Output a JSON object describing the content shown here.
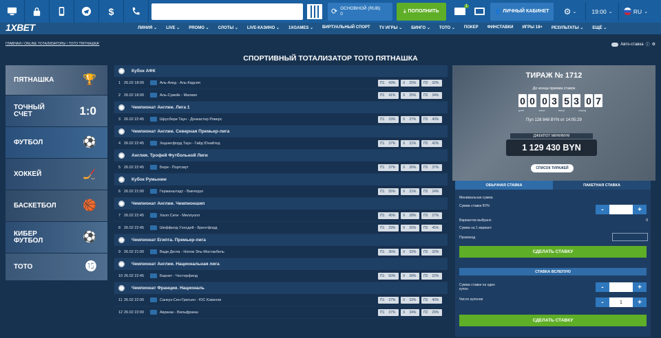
{
  "topbar": {
    "account_label": "ОСНОВНОЙ (RUB)",
    "account_value": "0",
    "deposit_label": "ПОПОЛНИТЬ",
    "mail_count": "1",
    "cabinet_label": "ЛИЧНЫЙ КАБИНЕТ",
    "time": "19:00",
    "language": "RU"
  },
  "nav": {
    "logo": "1XBET",
    "items": [
      "ЛИНИЯ ⌄",
      "LIVE ⌄",
      "PROMO ⌄",
      "СЛОТЫ ⌄",
      "LIVE-КАЗИНО ⌄",
      "1XGAMES ⌄",
      "ВИРТУАЛЬНЫЙ СПОРТ",
      "TV ИГРЫ ⌄",
      "БИНГО ⌄",
      "ТОТО ⌄",
      "ПОКЕР",
      "ФИНСТАВКИ",
      "ИГРЫ 18+",
      "РЕЗУЛЬТАТЫ ⌄",
      "ЕЩЁ ⌄"
    ]
  },
  "breadcrumb": "ГЛАВНАЯ / ONLINE ТОТАЛИЗАТОРЫ / ТОТО 'ПЯТНАШКА'",
  "autobet_label": "Авто-ставка",
  "page_title": "СПОРТИВНЫЙ ТОТАЛИЗАТОР ТОТО ПЯТНАШКА",
  "sidebar": [
    {
      "label": "ПЯТНАШКА",
      "icon": "trophy-icon"
    },
    {
      "label": "ТОЧНЫЙ СЧЕТ",
      "icon": "score-text",
      "extra": "1:0"
    },
    {
      "label": "ФУТБОЛ",
      "icon": "football-icon"
    },
    {
      "label": "ХОККЕЙ",
      "icon": "puck-icon"
    },
    {
      "label": "БАСКЕТБОЛ",
      "icon": "basketball-icon"
    },
    {
      "label": "КИБЕР ФУТБОЛ",
      "icon": "cyber-football-icon"
    },
    {
      "label": "ТОТО",
      "icon": "toto-icon"
    }
  ],
  "matches": [
    {
      "league": "Кубок АФК",
      "num": "1",
      "dt": "26.02 18:00",
      "teams": "Аль-Ахед - Аль-Кадсия",
      "p1": "43%",
      "x": "25%",
      "p2": "32%"
    },
    {
      "league": "",
      "num": "2",
      "dt": "26.02 18:00",
      "teams": "Аль-Сувейк - Малкия",
      "p1": "41%",
      "x": "25%",
      "p2": "34%"
    },
    {
      "league": "Чемпионат Англии. Лига 1",
      "num": "3",
      "dt": "26.02 22:45",
      "teams": "Шрусбери Таун - Донкастер Роверс",
      "p1": "33%",
      "x": "27%",
      "p2": "40%"
    },
    {
      "league": "Чемпионат Англии. Северная Премьер-лига",
      "num": "4",
      "dt": "26.02 22:45",
      "teams": "Хеднесфорд Таун - Гайд Юнайтед",
      "p1": "37%",
      "x": "21%",
      "p2": "42%"
    },
    {
      "league": "Англия. Трофей Футбольной Лиги",
      "num": "5",
      "dt": "26.02 22:45",
      "teams": "Бери - Портсмут",
      "p1": "37%",
      "x": "26%",
      "p2": "37%"
    },
    {
      "league": "Кубок Румынии",
      "num": "6",
      "dt": "26.02 21:00",
      "teams": "Германштадт - Виитеруп",
      "p1": "55%",
      "x": "21%",
      "p2": "24%"
    },
    {
      "league": "Чемпионат Англии. Чемпионшип",
      "num": "7",
      "dt": "26.02 22:45",
      "teams": "Халл Сити - Миллуолл",
      "p1": "45%",
      "x": "28%",
      "p2": "27%"
    },
    {
      "league": "",
      "num": "8",
      "dt": "26.02 22:45",
      "teams": "Шеффилд Уэнсдей - Брентфорд",
      "p1": "29%",
      "x": "26%",
      "p2": "45%"
    },
    {
      "league": "Чемпионат Египта. Премьер-лига",
      "num": "9",
      "dt": "26.02 21:00",
      "teams": "Вади Дегла - Ногом Эль-Мостакбель",
      "p1": "36%",
      "x": "32%",
      "p2": "32%"
    },
    {
      "league": "Чемпионат Англии. Национальная лига",
      "num": "10",
      "dt": "26.02 22:45",
      "teams": "Барнет - Честерфилд",
      "p1": "50%",
      "x": "28%",
      "p2": "22%"
    },
    {
      "league": "Чемпионат Франции. Националь",
      "num": "11",
      "dt": "26.02 22:00",
      "teams": "Санкуэ-Сен-Гратьен - ЮС Кэвилли",
      "p1": "27%",
      "x": "33%",
      "p2": "40%"
    },
    {
      "league": "",
      "num": "12",
      "dt": "26.02 22:00",
      "teams": "Авранш - Вильфранш",
      "p1": "37%",
      "x": "34%",
      "p2": "29%"
    }
  ],
  "odds_labels": {
    "p1": "П1",
    "x": "X",
    "p2": "П2"
  },
  "draw": {
    "title": "ТИРАЖ № 1712",
    "subtitle": "До конца приема ставок",
    "timer_digits": [
      "0",
      "0",
      "0",
      "3",
      "5",
      "3",
      "0",
      "7"
    ],
    "timer_labels": [
      "дней",
      "часов",
      "минут",
      "секунд"
    ],
    "pool": "Пул 128 848 BYN от 14:05:29",
    "jackpot_label": "ДЖЕКПОТ МИНИМУМ",
    "jackpot": "1 129 430 BYN",
    "list_button": "СПИСОК ТИРАЖЕЙ"
  },
  "bet": {
    "tab_regular": "ОБЫЧНАЯ СТАВКА",
    "tab_package": "ПАКЕТНАЯ СТАВКА",
    "min_sum": "Минимальная сумма",
    "bet_sum": "Сумма ставки BYN",
    "variants": "Вариантов выбрано",
    "variants_value": "0",
    "one_variant": "Сумма на 1 вариант",
    "promo": "Промокод",
    "make_bet": "СДЕЛАТЬ СТАВКУ",
    "blind_title": "СТАВКА ВСЛЕПУЮ",
    "coupon_sum": "Сумма ставки на один купон",
    "coupons": "Число купонов",
    "coupons_value": "1",
    "make_bet_2": "СДЕЛАТЬ СТАВКУ"
  }
}
